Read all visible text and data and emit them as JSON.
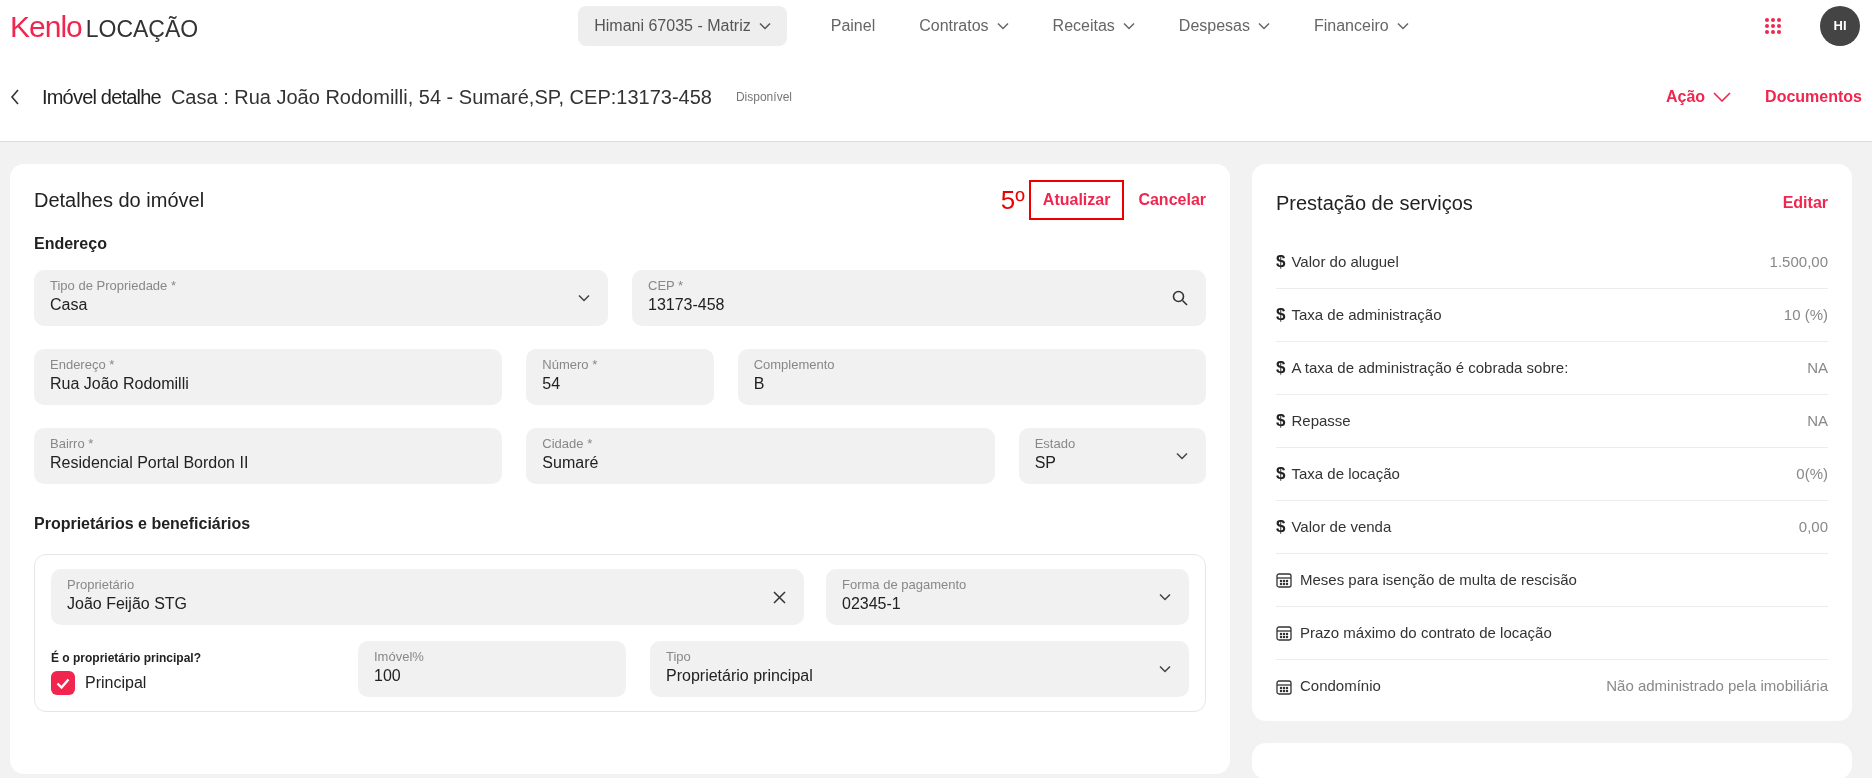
{
  "logo": {
    "brand": "Kenlo",
    "product": "LOCAÇÃO"
  },
  "nav": {
    "branch": "Himani 67035 - Matriz",
    "items": [
      {
        "label": "Painel",
        "dropdown": false
      },
      {
        "label": "Contratos",
        "dropdown": true
      },
      {
        "label": "Receitas",
        "dropdown": true
      },
      {
        "label": "Despesas",
        "dropdown": true
      },
      {
        "label": "Financeiro",
        "dropdown": true
      }
    ],
    "avatar": "HI"
  },
  "page_header": {
    "title": "Imóvel detalhe",
    "subtitle": "Casa : Rua João Rodomilli, 54 - Sumaré,SP, CEP:13173-458",
    "status": "Disponível",
    "action": "Ação",
    "documents": "Documentos"
  },
  "details": {
    "title": "Detalhes do imóvel",
    "step_mark": "5º",
    "update": "Atualizar",
    "cancel": "Cancelar",
    "address_heading": "Endereço",
    "address_rows": [
      [
        {
          "label": "Tipo de Propriedade *",
          "value": "Casa",
          "kind": "select"
        },
        {
          "label": "CEP *",
          "value": "13173-458",
          "kind": "search"
        }
      ],
      [
        {
          "label": "Endereço *",
          "value": "Rua João Rodomilli"
        },
        {
          "label": "Número *",
          "value": "54"
        },
        {
          "label": "Complemento",
          "value": "B"
        }
      ],
      [
        {
          "label": "Bairro *",
          "value": "Residencial Portal Bordon II"
        },
        {
          "label": "Cidade *",
          "value": "Sumaré"
        },
        {
          "label": "Estado",
          "value": "SP",
          "kind": "select"
        }
      ]
    ],
    "owners_heading": "Proprietários e beneficiários",
    "owner": {
      "owner_field": {
        "label": "Proprietário",
        "value": "João Feijão STG",
        "kind": "clearable"
      },
      "payment_field": {
        "label": "Forma de pagamento",
        "value": "02345-1",
        "kind": "select"
      },
      "principal_question": "É o proprietário principal?",
      "principal_label": "Principal",
      "checked": true,
      "share_field": {
        "label": "Imóvel%",
        "value": "100"
      },
      "type_field": {
        "label": "Tipo",
        "value": "Proprietário principal",
        "kind": "select"
      }
    }
  },
  "services": {
    "title": "Prestação de serviços",
    "edit": "Editar",
    "rows": [
      {
        "kind": "money",
        "symbol": "$",
        "label": "Valor do aluguel",
        "value": "1.500,00"
      },
      {
        "kind": "money",
        "symbol": "$",
        "label": "Taxa de administração",
        "value": "10 (%)"
      },
      {
        "kind": "money",
        "symbol": "$",
        "label": "A taxa de administração é cobrada sobre:",
        "value": "NA"
      },
      {
        "kind": "money",
        "symbol": "$",
        "label": "Repasse",
        "value": "NA"
      },
      {
        "kind": "money",
        "symbol": "$",
        "label": "Taxa de locação",
        "value": "0(%)"
      },
      {
        "kind": "money",
        "symbol": "$",
        "label": "Valor de venda",
        "value": "0,00"
      },
      {
        "kind": "calendar",
        "label": "Meses para isenção de multa de rescisão"
      },
      {
        "kind": "calendar",
        "label": "Prazo máximo do contrato de locação"
      },
      {
        "kind": "calendar",
        "label": "Condomínio",
        "value": "Não administrado pela imobiliária"
      }
    ]
  }
}
